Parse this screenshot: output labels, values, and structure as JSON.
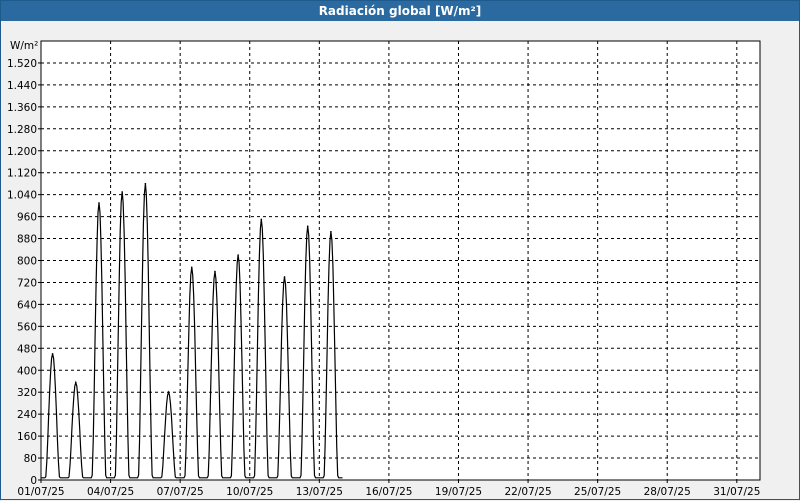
{
  "window": {
    "title": "Radiación global [W/m²]"
  },
  "chart_data": {
    "type": "line",
    "title": "Radiación global [W/m²]",
    "ylabel": "W/m²",
    "xlabel": "",
    "ylim": [
      0,
      1600
    ],
    "xlim_days": [
      1,
      32
    ],
    "grid": true,
    "y_ticks": [
      "0",
      "80",
      "160",
      "240",
      "320",
      "400",
      "480",
      "560",
      "640",
      "720",
      "800",
      "880",
      "960",
      "1.040",
      "1.120",
      "1.200",
      "1.280",
      "1.360",
      "1.440",
      "1.520"
    ],
    "x_ticks": [
      "01/07/25",
      "04/07/25",
      "07/07/25",
      "10/07/25",
      "13/07/25",
      "16/07/25",
      "19/07/25",
      "22/07/25",
      "25/07/25",
      "28/07/25",
      "31/07/25"
    ],
    "series": [
      {
        "color": "#000000",
        "daily_peaks": [
          {
            "date": "01/07/25",
            "peak": 460
          },
          {
            "date": "02/07/25",
            "peak": 355
          },
          {
            "date": "03/07/25",
            "peak": 1010
          },
          {
            "date": "04/07/25",
            "peak": 1050
          },
          {
            "date": "05/07/25",
            "peak": 1080
          },
          {
            "date": "06/07/25",
            "peak": 320
          },
          {
            "date": "07/07/25",
            "peak": 775
          },
          {
            "date": "08/07/25",
            "peak": 760
          },
          {
            "date": "09/07/25",
            "peak": 820
          },
          {
            "date": "10/07/25",
            "peak": 950
          },
          {
            "date": "11/07/25",
            "peak": 740
          },
          {
            "date": "12/07/25",
            "peak": 925
          },
          {
            "date": "13/07/25",
            "peak": 905
          }
        ]
      }
    ]
  }
}
